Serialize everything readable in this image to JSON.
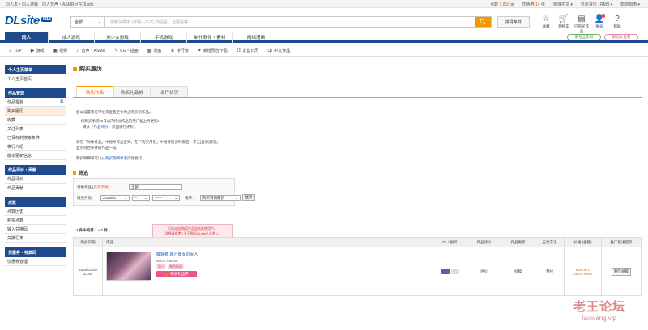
{
  "topbar": {
    "left": "同人本・同人游戏・同人音声・ASMR尽在DLsite",
    "points_label": "点数",
    "points_value": "1,818",
    "points_unit": "pt",
    "coupon_label": "优惠券",
    "coupon_value": "14",
    "coupon_unit": "张",
    "lang": "简体中文 ▾",
    "currency": "显示货币 : RMB ▾",
    "help": "帮助指南 ▾"
  },
  "header": {
    "logo": "DLsite",
    "logo_tag": "R18",
    "search_category": "全部",
    "search_placeholder": "搜索关键字 (可输入中文)  作品名、社团名等",
    "advanced_label": "搜寻条件",
    "icons": [
      {
        "label": "收藏",
        "glyph": "☆"
      },
      {
        "label": "购物车",
        "glyph": "🛒"
      },
      {
        "label": "已购买作品",
        "glyph": "▤"
      },
      {
        "label": "账号",
        "glyph": "👤",
        "badge": "2"
      },
      {
        "label": "帮助",
        "glyph": "?"
      }
    ]
  },
  "nav": {
    "items": [
      "同人",
      "成人游戏",
      "美少女游戏",
      "手机游戏",
      "制作软件・素材",
      "网络漫画"
    ],
    "btn1": "前往全年龄",
    "btn2": "前往女性向"
  },
  "subnav": [
    {
      "icon": "⌂",
      "label": "TOP"
    },
    {
      "icon": "▶",
      "label": "游戏"
    },
    {
      "icon": "▣",
      "label": "视频"
    },
    {
      "icon": "♫",
      "label": "音声・ASMR"
    },
    {
      "icon": "✎",
      "label": "CG・插画"
    },
    {
      "icon": "▦",
      "label": "漫画"
    },
    {
      "icon": "♛",
      "label": "排行榜"
    },
    {
      "icon": "✦",
      "label": "新增预告作品"
    },
    {
      "icon": "☷",
      "label": "发售日历"
    },
    {
      "icon": "中",
      "label": "中文作品"
    }
  ],
  "sidebar": [
    {
      "header": "个人主页菜单",
      "items": [
        {
          "label": "个人主页首页"
        }
      ]
    },
    {
      "header": "作品管理",
      "items": [
        {
          "label": "作品报档",
          "ext": "⧉"
        },
        {
          "label": "购买履历",
          "active": true
        },
        {
          "label": "收藏"
        },
        {
          "label": "关注列表"
        },
        {
          "label": "已保存的搜索条件"
        },
        {
          "label": "横行介绍"
        },
        {
          "label": "版本更新信息"
        }
      ]
    },
    {
      "header": "作品评价・贡献",
      "items": [
        {
          "label": "作品评价"
        },
        {
          "label": "作品贡献"
        }
      ]
    },
    {
      "header": "点数",
      "items": [
        {
          "label": "点数历史"
        },
        {
          "label": "购买点数"
        },
        {
          "label": "输入兑换码"
        },
        {
          "label": "兑换汇率"
        }
      ]
    },
    {
      "header": "优惠券・特典码",
      "items": [
        {
          "label": "优惠券管理"
        }
      ]
    }
  ],
  "main": {
    "title": "购买履历",
    "tabs": [
      "购买作品",
      "购买礼品券",
      "发行状况"
    ],
    "intro1": "您以设置现在单位来查看至今为止购买的作品。",
    "intro2": "・ 将购买承诺90日以内评价作品的用户留上终更购!",
    "intro3a": "请从「",
    "intro3_link": "作品评价",
    "intro3b": "」页面进行评价。",
    "intro4": "请在「对象作品」中搜寻作品查询，在「购买月份」中搜寻购买时期后，点击[显示]按钮。",
    "intro5": "显示符合条件的作品一览。",
    "intro6a": "购买明细单可以从",
    "intro6_link": "购买明细单发行",
    "intro6b": "处发行。",
    "filter_title": "筛选",
    "target_label": "对象作品 [",
    "target_link": "选项不限",
    "target_end": "]：",
    "target_value": "全部",
    "month_label": "购买月份：",
    "year_value": "2025/01",
    "month2_value": "--",
    "month3_value": "------",
    "sort_label": "排序：",
    "sort_value": "购买日期最新",
    "show_button": "显示",
    "count": "1 件中的第 1 ~ 1 件",
    "tooltip1": "可以追加购买作品送给其他用户。",
    "tooltip2": "详细请参考 [ 关于购买DLsite礼品券 ]。",
    "columns": [
      "购买日期",
      "作品",
      "DL / 视听",
      "作品评价",
      "作品更新",
      "支付方法",
      "价格 (金额)",
      "推广描述提取"
    ],
    "row": {
      "date": "2025/01/10",
      "time": "23:58",
      "work_title": "藤罪者 妹と彼女の女人",
      "circle": "Witch Pantsu",
      "tag1": "同人",
      "tag2": "角色扮演",
      "gift_button": "购买礼品券",
      "review": "评价",
      "update": "投稿",
      "payment": "预付",
      "price": "605 JPY",
      "price_rmb": "28.15 RMB",
      "action": "制作规履"
    }
  },
  "watermark": {
    "title": "老王论坛",
    "url": "laowang.vip"
  }
}
